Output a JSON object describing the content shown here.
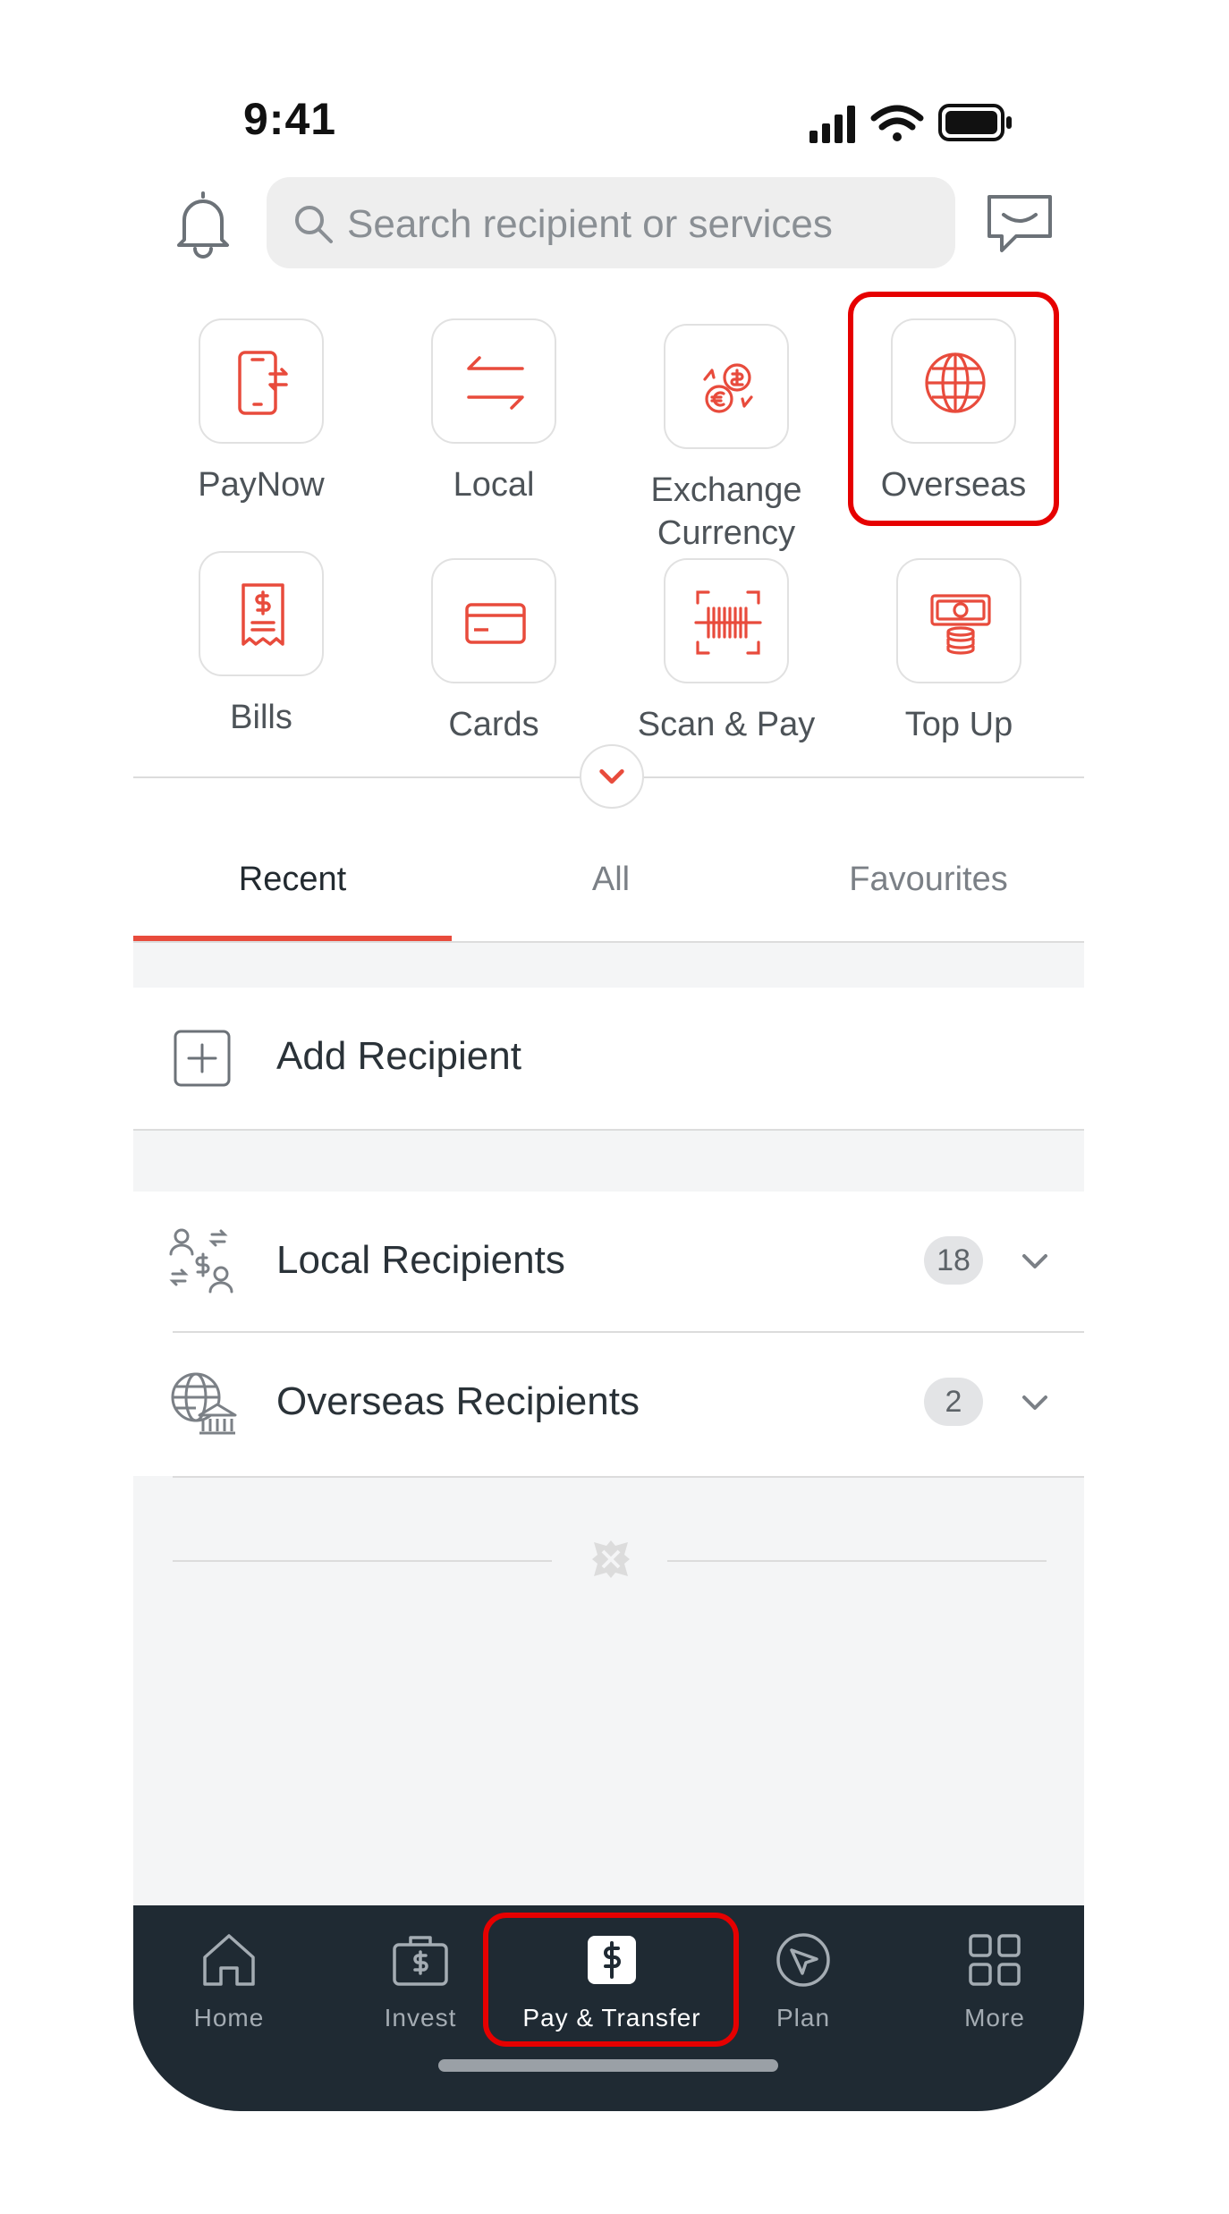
{
  "status_bar": {
    "time": "9:41"
  },
  "header": {
    "search_placeholder": "Search recipient or services"
  },
  "quick_actions": [
    {
      "label": "PayNow",
      "icon": "paynow-phone-icon"
    },
    {
      "label": "Local",
      "icon": "local-transfer-arrows-icon"
    },
    {
      "label": "Exchange Currency",
      "line1": "Exchange",
      "line2": "Currency",
      "icon": "exchange-currency-icon"
    },
    {
      "label": "Overseas",
      "icon": "globe-icon"
    },
    {
      "label": "Bills",
      "icon": "bill-receipt-icon"
    },
    {
      "label": "Cards",
      "icon": "credit-card-icon"
    },
    {
      "label": "Scan & Pay",
      "icon": "barcode-scan-icon"
    },
    {
      "label": "Top Up",
      "icon": "top-up-cash-icon"
    }
  ],
  "tabs": [
    {
      "label": "Recent",
      "active": true
    },
    {
      "label": "All",
      "active": false
    },
    {
      "label": "Favourites",
      "active": false
    }
  ],
  "list": {
    "add_recipient": "Add Recipient",
    "local_recipients": {
      "label": "Local Recipients",
      "count": "18"
    },
    "overseas_recipients": {
      "label": "Overseas Recipients",
      "count": "2"
    }
  },
  "bottom_nav": [
    {
      "label": "Home",
      "icon": "home-icon"
    },
    {
      "label": "Invest",
      "icon": "invest-briefcase-icon"
    },
    {
      "label": "Pay & Transfer",
      "icon": "pay-transfer-dollar-icon",
      "active": true
    },
    {
      "label": "Plan",
      "icon": "plan-compass-icon"
    },
    {
      "label": "More",
      "icon": "more-grid-icon"
    }
  ],
  "colors": {
    "accent": "#e84b3c",
    "highlight": "#e60000",
    "nav_bg": "#1f2a33"
  }
}
